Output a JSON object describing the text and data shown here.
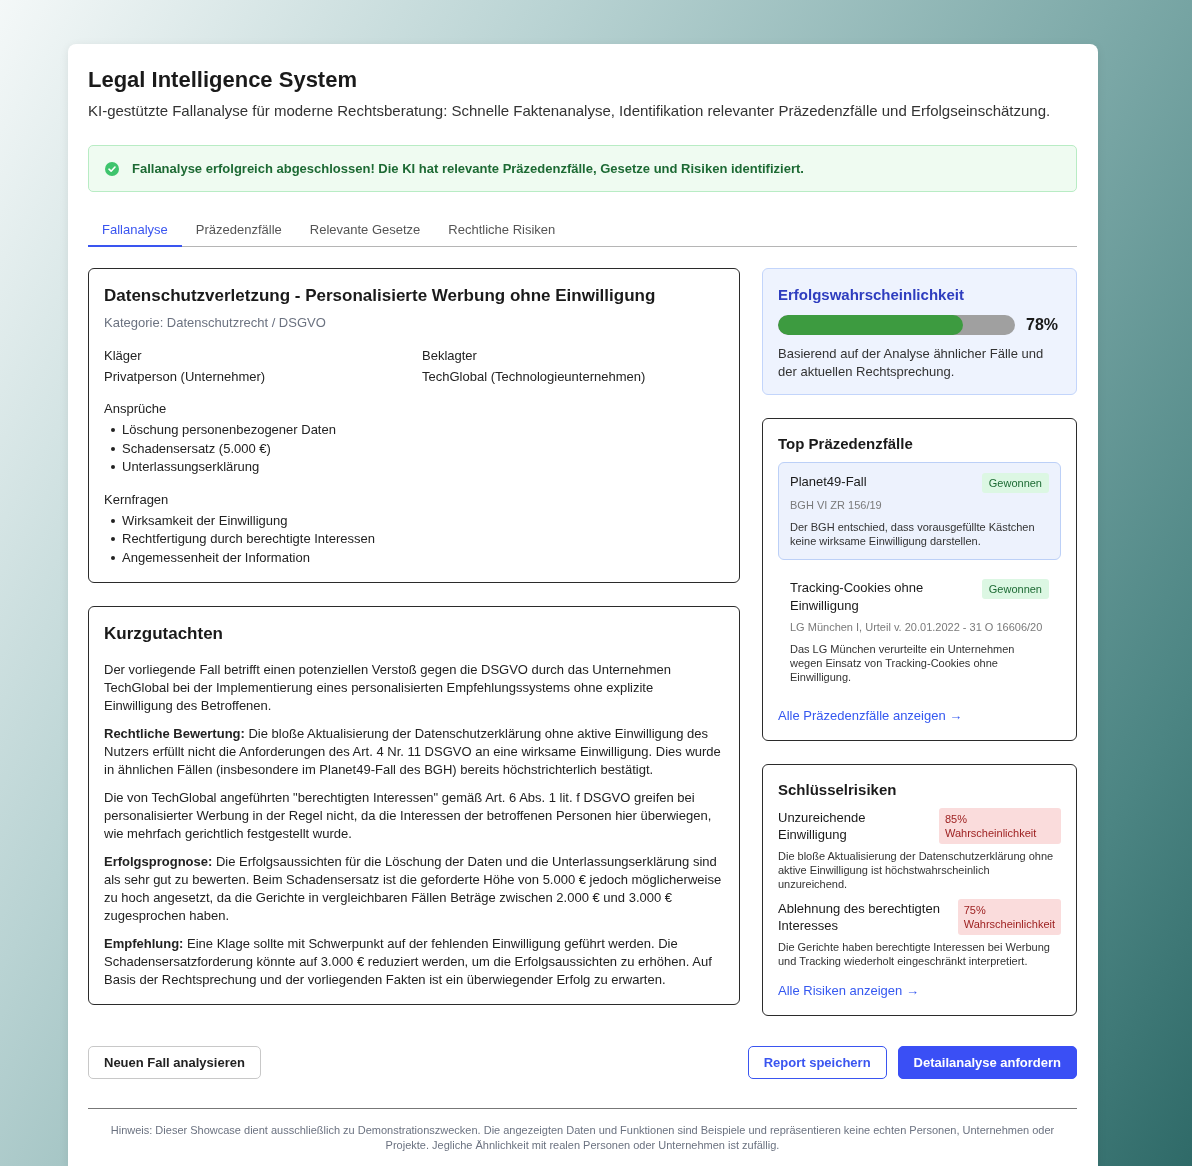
{
  "header": {
    "title": "Legal Intelligence System",
    "subtitle": "KI-gestützte Fallanalyse für moderne Rechtsberatung: Schnelle Faktenanalyse, Identifikation relevanter Präzedenzfälle und Erfolgseinschätzung."
  },
  "alert": {
    "kind": "success",
    "message": "Fallanalyse erfolgreich abgeschlossen! Die KI hat relevante Präzedenzfälle, Gesetze und Risiken identifiziert."
  },
  "tabs": [
    {
      "label": "Fallanalyse",
      "selected": true
    },
    {
      "label": "Präzedenzfälle",
      "selected": false
    },
    {
      "label": "Relevante Gesetze",
      "selected": false
    },
    {
      "label": "Rechtliche Risiken",
      "selected": false
    }
  ],
  "case": {
    "title": "Datenschutzverletzung - Personalisierte Werbung ohne Einwilligung",
    "category": "Kategorie: Datenschutzrecht / DSGVO",
    "parties": [
      {
        "label": "Kläger",
        "value": "Privatperson (Unternehmer)"
      },
      {
        "label": "Beklagter",
        "value": "TechGlobal (Technologieunternehmen)"
      }
    ],
    "lists": [
      {
        "label": "Ansprüche",
        "items": [
          "Löschung personenbezogener Daten",
          "Schadensersatz (5.000 €)",
          "Unterlassungserklärung"
        ]
      },
      {
        "label": "Kernfragen",
        "items": [
          "Wirksamkeit der Einwilligung",
          "Rechtfertigung durch berechtigte Interessen",
          "Angemessenheit der Information"
        ]
      }
    ]
  },
  "opinion": {
    "title": "Kurzgutachten",
    "paragraphs": [
      "Der vorliegende Fall betrifft einen potenziellen Verstoß gegen die DSGVO durch das Unternehmen TechGlobal bei der Implementierung eines personalisierten Empfehlungssystems ohne explizite Einwilligung des Betroffenen.",
      "**Rechtliche Bewertung:** Die bloße Aktualisierung der Datenschutzerklärung ohne aktive Einwilligung des Nutzers erfüllt nicht die Anforderungen des Art. 4 Nr. 11 DSGVO an eine wirksame Einwilligung. Dies wurde in ähnlichen Fällen (insbesondere im Planet49-Fall des BGH) bereits höchstrichterlich bestätigt.",
      "Die von TechGlobal angeführten \"berechtigten Interessen\" gemäß Art. 6 Abs. 1 lit. f DSGVO greifen bei personalisierter Werbung in der Regel nicht, da die Interessen der betroffenen Personen hier überwiegen, wie mehrfach gerichtlich festgestellt wurde.",
      "**Erfolgsprognose:** Die Erfolgsaussichten für die Löschung der Daten und die Unterlassungserklärung sind als sehr gut zu bewerten. Beim Schadensersatz ist die geforderte Höhe von 5.000 € jedoch möglicherweise zu hoch angesetzt, da die Gerichte in vergleichbaren Fällen Beträge zwischen 2.000 € und 3.000 € zugesprochen haben.",
      "**Empfehlung:** Eine Klage sollte mit Schwerpunkt auf der fehlenden Einwilligung geführt werden. Die Schadensersatzforderung könnte auf 3.000 € reduziert werden, um die Erfolgsaussichten zu erhöhen. Auf Basis der Rechtsprechung und der vorliegenden Fakten ist ein überwiegender Erfolg zu erwarten."
    ]
  },
  "success_probability": {
    "title": "Erfolgswahrscheinlichkeit",
    "level": 0.78,
    "reading": "78%",
    "note": "Basierend auf der Analyse ähnlicher Fälle und der aktuellen Rechtsprechung."
  },
  "precedents": {
    "title": "Top Präzedenzfälle",
    "items": [
      {
        "name": "Planet49-Fall",
        "status": "Gewonnen",
        "reference": "BGH VI ZR 156/19",
        "summary": "Der BGH entschied, dass vorausgefüllte Kästchen keine wirksame Einwilligung darstellen.",
        "selected": true
      },
      {
        "name": "Tracking-Cookies ohne Einwilligung",
        "status": "Gewonnen",
        "reference": "LG München I, Urteil v. 20.01.2022 - 31 O 16606/20",
        "summary": "Das LG München verurteilte ein Unternehmen wegen Einsatz von Tracking-Cookies ohne Einwilligung.",
        "selected": false
      }
    ],
    "link": "Alle Präzedenzfälle anzeigen →"
  },
  "risks": {
    "title": "Schlüsselrisiken",
    "items": [
      {
        "name": "Unzureichende Einwilligung",
        "probability": "85% Wahrscheinlichkeit",
        "description": "Die bloße Aktualisierung der Datenschutzerklärung ohne aktive Einwilligung ist höchstwahrscheinlich unzureichend."
      },
      {
        "name": "Ablehnung des berechtigten Interesses",
        "probability": "75% Wahrscheinlichkeit",
        "description": "Die Gerichte haben berechtigte Interessen bei Werbung und Tracking wiederholt eingeschränkt interpretiert."
      }
    ],
    "link": "Alle Risiken anzeigen →"
  },
  "actions": {
    "start": [
      {
        "label": "Neuen Fall analysieren",
        "kind": "secondary"
      }
    ],
    "end": [
      {
        "label": "Report speichern",
        "kind": "outline"
      },
      {
        "label": "Detailanalyse anfordern",
        "kind": "primary"
      }
    ]
  },
  "footer": {
    "note": "Hinweis: Dieser Showcase dient ausschließlich zu Demonstrationszwecken. Die angezeigten Daten und Funktionen sind Beispiele und repräsentieren keine echten Personen, Unternehmen oder Projekte. Jegliche Ähnlichkeit mit realen Personen oder Unternehmen ist zufällig."
  }
}
